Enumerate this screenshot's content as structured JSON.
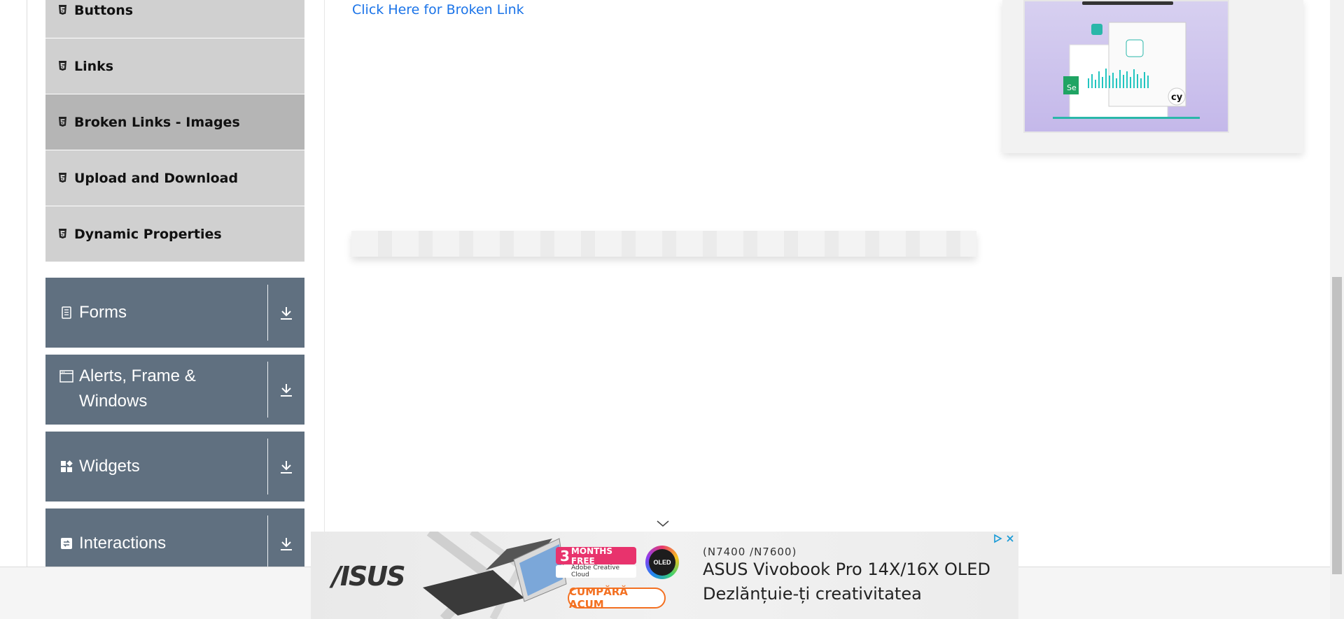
{
  "sidebar": {
    "elements_items": [
      {
        "label": "Buttons",
        "active": false
      },
      {
        "label": "Links",
        "active": false
      },
      {
        "label": "Broken Links - Images",
        "active": true
      },
      {
        "label": "Upload and Download",
        "active": false
      },
      {
        "label": "Dynamic Properties",
        "active": false
      }
    ],
    "groups": [
      {
        "title": "Forms"
      },
      {
        "title_line1": "Alerts, Frame &",
        "title_line2": "Windows"
      },
      {
        "title": "Widgets"
      },
      {
        "title": "Interactions"
      }
    ]
  },
  "main": {
    "broken_link_text": "Click Here for Broken Link"
  },
  "ad": {
    "brand": "/ISUS",
    "offer_number": "3",
    "offer_text": "MONTHS FREE",
    "offer_partner": "Adobe Creative Cloud",
    "oled_badge": "OLED",
    "cta": "CUMPĂRĂ ACUM",
    "model": "(N7400 /N7600)",
    "headline": "ASUS Vivobook Pro 14X/16X OLED",
    "subline": "Dezlănțuie-ți creativitatea"
  },
  "colors": {
    "group_bg": "#607080",
    "submenu_bg": "#d0d0d0",
    "submenu_active_bg": "#b5b5b5",
    "link": "#1a73e8"
  }
}
